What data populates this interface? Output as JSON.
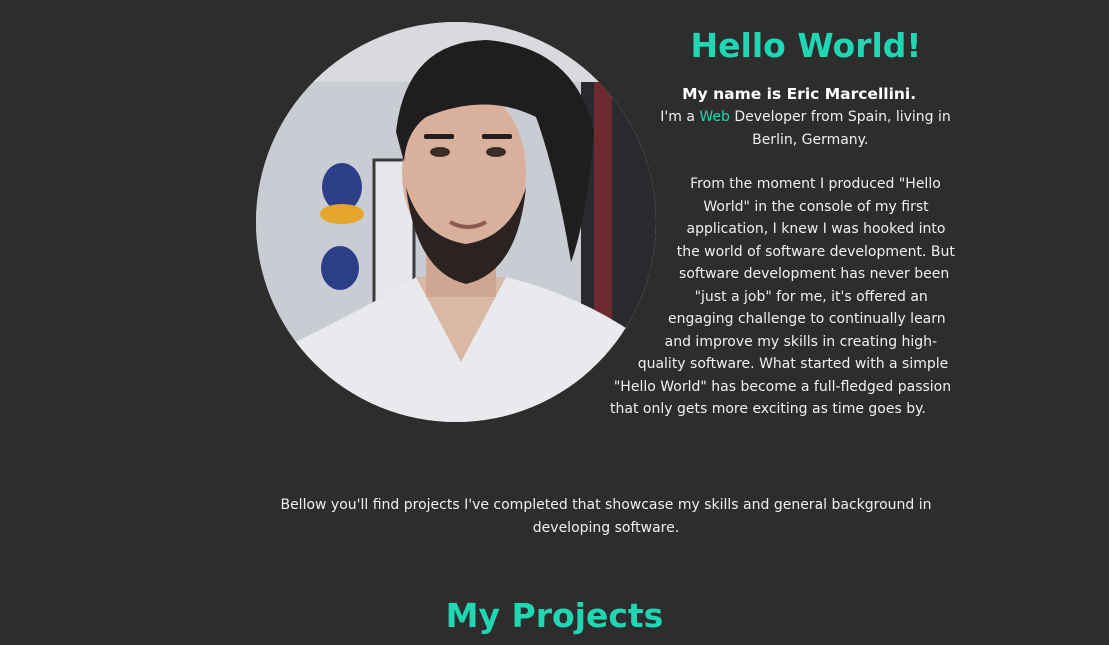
{
  "hero": {
    "title": "Hello World!",
    "name_line": "My name is Eric Marcellini.",
    "role_prefix": "I'm a ",
    "role_accent": "Web",
    "role_suffix": " Developer from Spain, living in Berlin, Germany.",
    "story": "From the moment I produced \"Hello World\" in the console of my first application, I knew I was hooked into the world of software development. But software development has never been \"just a job\" for me, it's offered an engaging challenge to continually learn and improve my skills in creating high-quality software. What started with a simple \"Hello World\" has become a full-fledged passion that only gets more exciting as time goes by.",
    "bellow": "Bellow you'll find projects I've completed that showcase my skills and general background in developing software."
  },
  "projects": {
    "title": "My Projects"
  },
  "colors": {
    "background": "#2d2d2d",
    "accent": "#1fd8b3",
    "text": "#f0f0f0"
  }
}
